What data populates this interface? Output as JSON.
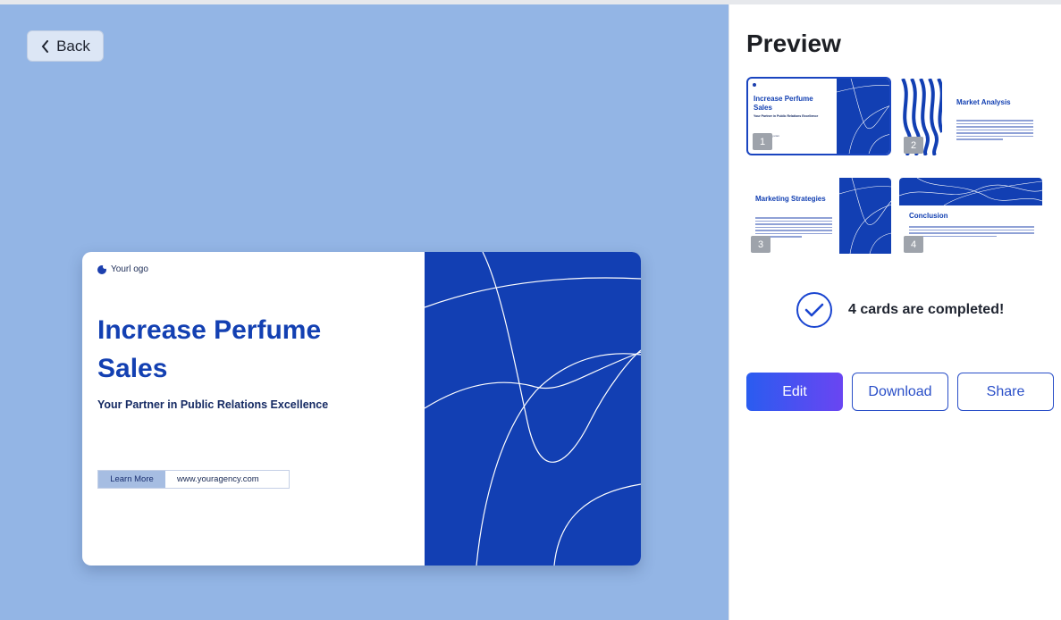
{
  "nav": {
    "back_label": "Back"
  },
  "slide": {
    "logo": "Yourl ogo",
    "title": "Increase Perfume Sales",
    "subtitle": "Your Partner in Public Relations Excellence",
    "cta_label": "Learn More",
    "url": "www.youragency.com"
  },
  "preview": {
    "title": "Preview",
    "cards": [
      {
        "number": "1",
        "title": "Increase Perfume Sales",
        "subtitle": "Your Partner in Public Relations Excellence",
        "url": "www.youragency.com"
      },
      {
        "number": "2",
        "title": "Market Analysis"
      },
      {
        "number": "3",
        "title": "Marketing Strategies"
      },
      {
        "number": "4",
        "title": "Conclusion"
      }
    ],
    "status_text": "4 cards are completed!",
    "buttons": {
      "edit": "Edit",
      "download": "Download",
      "share": "Share"
    }
  },
  "colors": {
    "canvas": "#93b5e5",
    "brand_blue": "#123fb3",
    "primary_gradient_start": "#2a5cf0",
    "primary_gradient_end": "#6a45f2"
  },
  "icons": {
    "back": "chevron-left-icon",
    "status": "check-circle-icon"
  }
}
